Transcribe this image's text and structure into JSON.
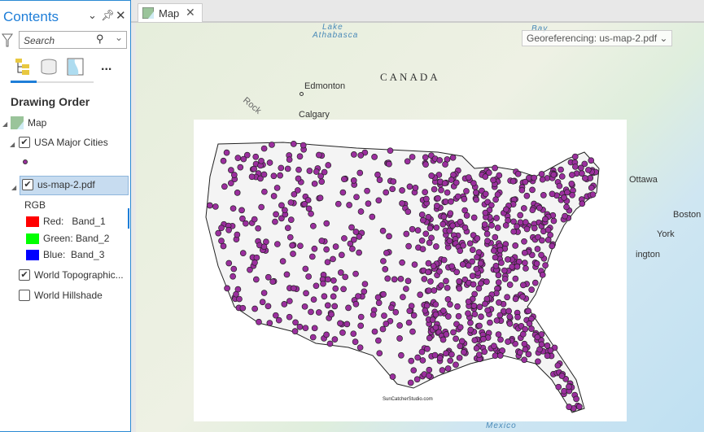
{
  "contents": {
    "title": "Contents",
    "search_placeholder": "Search",
    "heading": "Drawing Order",
    "more": "...",
    "layers": {
      "map": "Map",
      "cities": "USA Major Cities",
      "pdf": "us-map-2.pdf",
      "rgb": "RGB",
      "bands": [
        {
          "label": "Red:   Band_1",
          "color": "#ff0000"
        },
        {
          "label": "Green: Band_2",
          "color": "#00ff00"
        },
        {
          "label": "Blue:  Band_3",
          "color": "#0000ff"
        }
      ],
      "topo": "World Topographic...",
      "hillshade": "World Hillshade"
    },
    "checked": {
      "cities": true,
      "pdf": true,
      "topo": true,
      "hillshade": false
    }
  },
  "tab": {
    "label": "Map"
  },
  "map": {
    "georef": "Georeferencing: us-map-2.pdf",
    "labels": {
      "lake": "Lake",
      "athabasca": "Athabasca",
      "bay": "Bay",
      "canada": "CANADA",
      "edmonton": "Edmonton",
      "calgary": "Calgary",
      "rock": "Rock",
      "ottawa": "Ottawa",
      "boston": "Boston",
      "york": "York",
      "ington": "ington",
      "mexico": "Mexico"
    },
    "credit": "SunCatcherStudio.com",
    "point_color": "#9b2f9e"
  }
}
